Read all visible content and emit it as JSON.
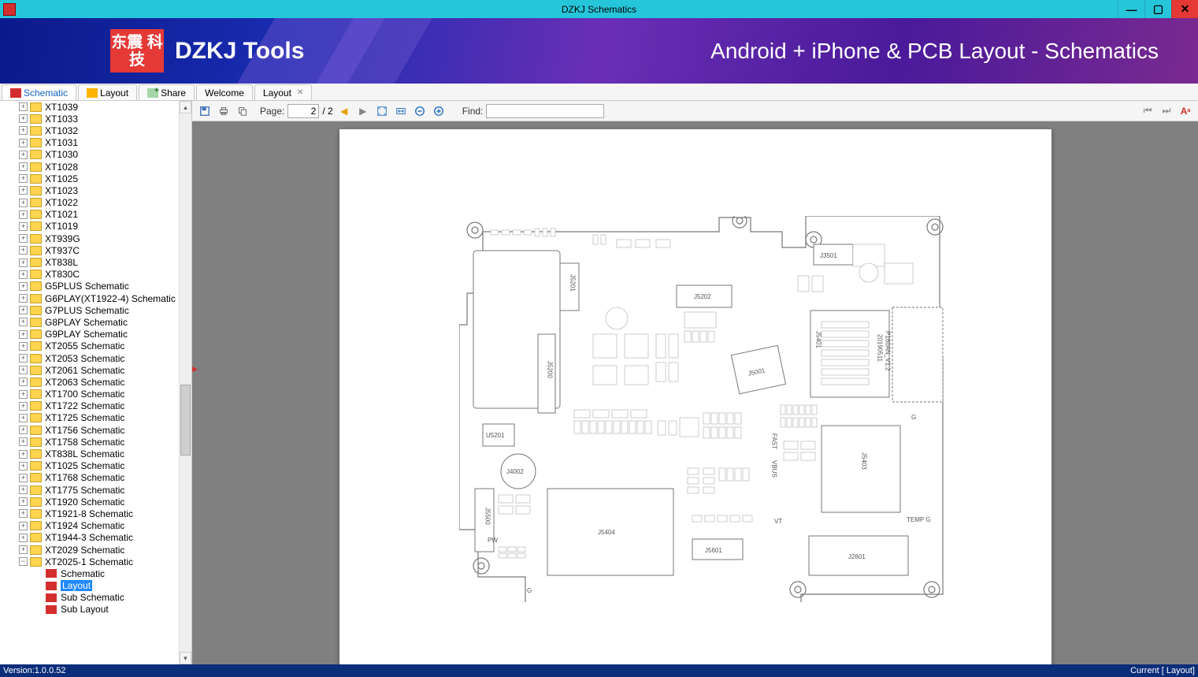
{
  "titlebar": {
    "title": "DZKJ Schematics"
  },
  "banner": {
    "logo_text": "东震\n科技",
    "brand": "DZKJ Tools",
    "tagline": "Android + iPhone & PCB Layout - Schematics"
  },
  "tabs": {
    "schematic": "Schematic",
    "layout": "Layout",
    "share": "Share",
    "welcome": "Welcome",
    "layout_doc": "Layout"
  },
  "toolbar": {
    "page_label": "Page:",
    "page_current": "2",
    "page_total": "/ 2",
    "find_label": "Find:",
    "find_value": ""
  },
  "tree": {
    "items": [
      {
        "label": "XT1039"
      },
      {
        "label": "XT1033"
      },
      {
        "label": "XT1032"
      },
      {
        "label": "XT1031"
      },
      {
        "label": "XT1030"
      },
      {
        "label": "XT1028"
      },
      {
        "label": "XT1025"
      },
      {
        "label": "XT1023"
      },
      {
        "label": "XT1022"
      },
      {
        "label": "XT1021"
      },
      {
        "label": "XT1019"
      },
      {
        "label": "XT939G"
      },
      {
        "label": "XT937C"
      },
      {
        "label": "XT838L"
      },
      {
        "label": "XT830C"
      },
      {
        "label": "G5PLUS Schematic"
      },
      {
        "label": "G6PLAY(XT1922-4) Schematic"
      },
      {
        "label": "G7PLUS Schematic"
      },
      {
        "label": "G8PLAY Schematic"
      },
      {
        "label": "G9PLAY Schematic"
      },
      {
        "label": "XT2055 Schematic"
      },
      {
        "label": "XT2053 Schematic"
      },
      {
        "label": "XT2061 Schematic"
      },
      {
        "label": "XT2063 Schematic"
      },
      {
        "label": "XT1700 Schematic"
      },
      {
        "label": "XT1722 Schematic"
      },
      {
        "label": "XT1725 Schematic"
      },
      {
        "label": "XT1756 Schematic"
      },
      {
        "label": "XT1758 Schematic"
      },
      {
        "label": "XT838L Schematic"
      },
      {
        "label": "XT1025 Schematic"
      },
      {
        "label": "XT1768 Schematic"
      },
      {
        "label": "XT1775 Schematic"
      },
      {
        "label": "XT1920 Schematic"
      },
      {
        "label": "XT1921-8 Schematic"
      },
      {
        "label": "XT1924 Schematic"
      },
      {
        "label": "XT1944-3 Schematic"
      },
      {
        "label": "XT2029 Schematic"
      },
      {
        "label": "XT2025-1 Schematic",
        "expanded": true
      }
    ],
    "children": [
      {
        "label": "Schematic"
      },
      {
        "label": "Layout",
        "selected": true
      },
      {
        "label": "Sub Schematic"
      },
      {
        "label": "Sub Layout"
      }
    ]
  },
  "pcb": {
    "labels": {
      "j5201": "J5201",
      "j5202": "J5202",
      "j3501": "J3501",
      "j5200": "J5200",
      "j5001": "J5001",
      "j5401": "J5401",
      "board": "P160AN_V1.2",
      "date": "20190511",
      "u5201": "U5201",
      "j4002": "J4002",
      "j5403": "J5403",
      "j5500": "J5500",
      "j5404": "J5404",
      "j5601": "J5601",
      "j2601": "J2601",
      "pw": "PW",
      "g1": "G",
      "g2": "G",
      "fast": "FAST",
      "vbus": "VBUS",
      "vt": "VT",
      "tempg": "TEMP G"
    }
  },
  "statusbar": {
    "version": "Version:1.0.0.52",
    "current": "Current [ Layout]"
  }
}
